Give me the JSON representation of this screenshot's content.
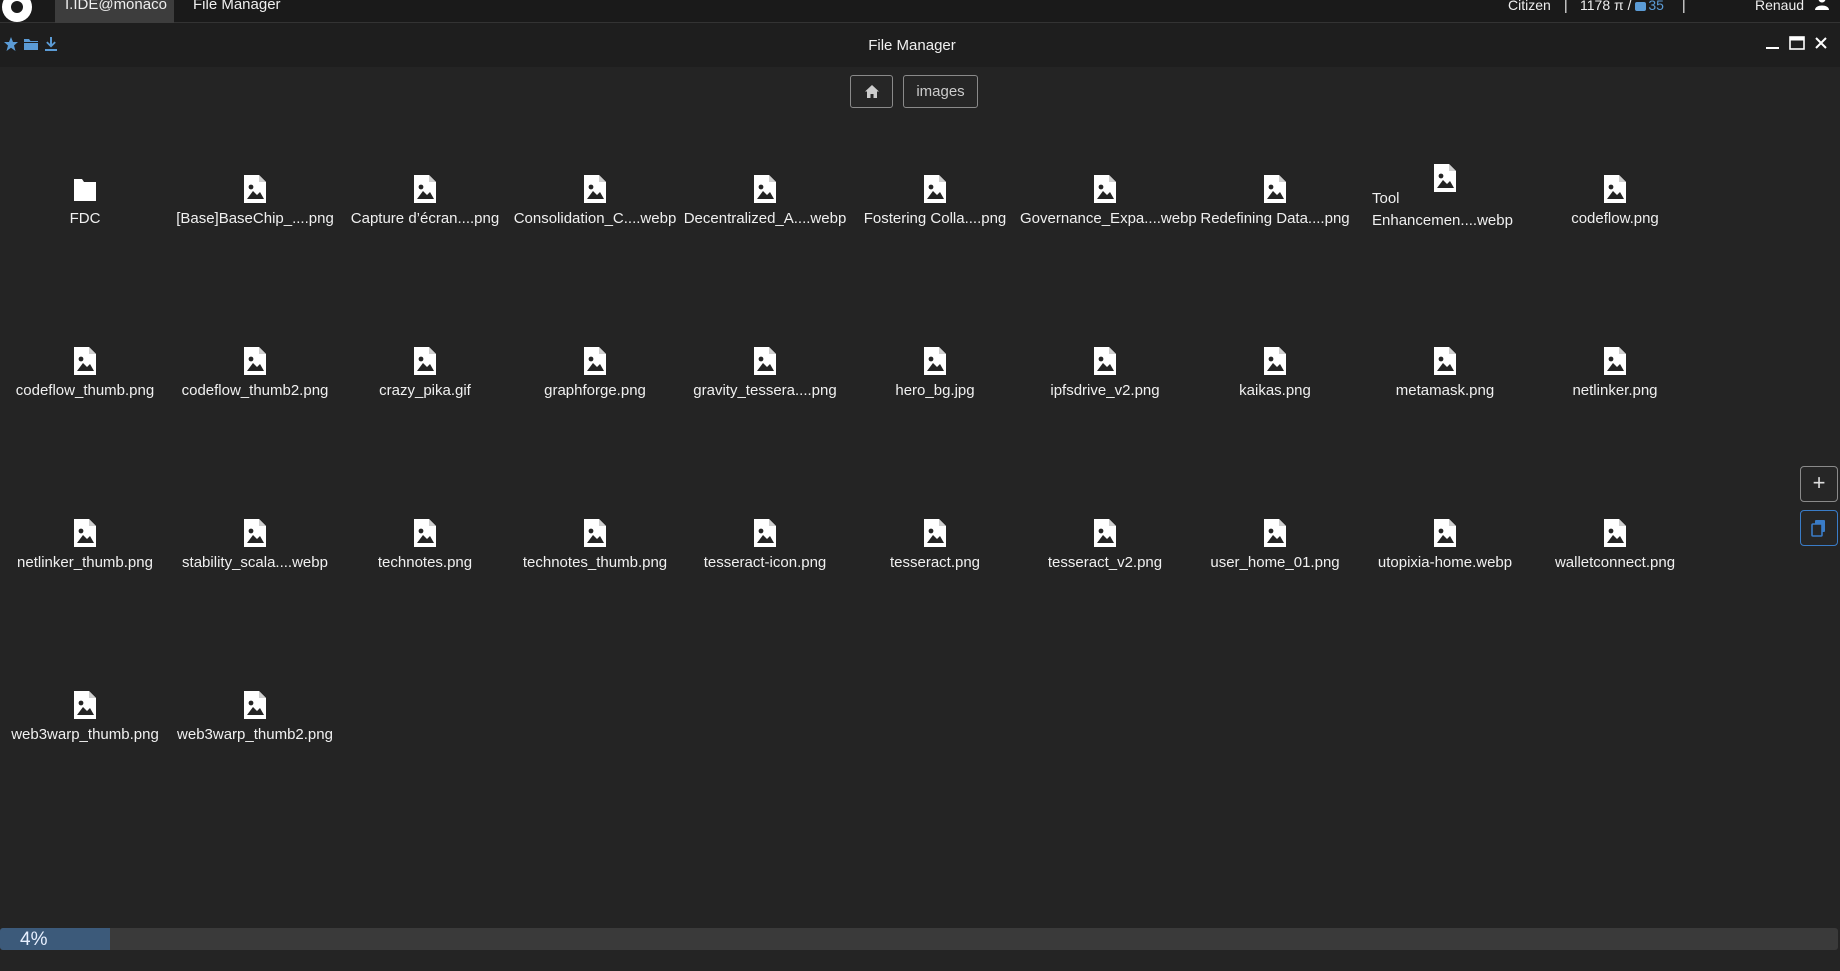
{
  "topbar": {
    "tabs": [
      "I.IDE@monaco",
      "File Manager"
    ],
    "role": "Citizen",
    "separator": "|",
    "balance_amount": "1178 π / ",
    "balance_count": "35",
    "user_name": "Renaud"
  },
  "window": {
    "title": "File Manager",
    "left_icons": [
      "star-icon",
      "folder-icon",
      "download-icon"
    ],
    "controls": [
      "minimize-icon",
      "maximize-icon",
      "close-icon"
    ]
  },
  "breadcrumb": {
    "home_icon": "home-icon",
    "current": "images"
  },
  "files": [
    {
      "name": "FDC",
      "kind": "folder"
    },
    {
      "name": "[Base]BaseChip_....png",
      "kind": "image"
    },
    {
      "name": "Capture d’écran....png",
      "kind": "image"
    },
    {
      "name": "Consolidation_C....webp",
      "kind": "image"
    },
    {
      "name": "Decentralized_A....webp",
      "kind": "image"
    },
    {
      "name": "Fostering Colla....png",
      "kind": "image"
    },
    {
      "name": "Governance_Expa....webp",
      "kind": "image"
    },
    {
      "name": "Redefining Data....png",
      "kind": "image"
    },
    {
      "name": "Tool Enhancemen....webp",
      "kind": "image",
      "wrap": true
    },
    {
      "name": "codeflow.png",
      "kind": "image"
    },
    {
      "name": "codeflow_thumb.png",
      "kind": "image"
    },
    {
      "name": "codeflow_thumb2.png",
      "kind": "image"
    },
    {
      "name": "crazy_pika.gif",
      "kind": "image"
    },
    {
      "name": "graphforge.png",
      "kind": "image"
    },
    {
      "name": "gravity_tessera....png",
      "kind": "image"
    },
    {
      "name": "hero_bg.jpg",
      "kind": "image"
    },
    {
      "name": "ipfsdrive_v2.png",
      "kind": "image"
    },
    {
      "name": "kaikas.png",
      "kind": "image"
    },
    {
      "name": "metamask.png",
      "kind": "image"
    },
    {
      "name": "netlinker.png",
      "kind": "image"
    },
    {
      "name": "netlinker_thumb.png",
      "kind": "image"
    },
    {
      "name": "stability_scala....webp",
      "kind": "image"
    },
    {
      "name": "technotes.png",
      "kind": "image"
    },
    {
      "name": "technotes_thumb.png",
      "kind": "image"
    },
    {
      "name": "tesseract-icon.png",
      "kind": "image"
    },
    {
      "name": "tesseract.png",
      "kind": "image"
    },
    {
      "name": "tesseract_v2.png",
      "kind": "image"
    },
    {
      "name": "user_home_01.png",
      "kind": "image"
    },
    {
      "name": "utopixia-home.webp",
      "kind": "image"
    },
    {
      "name": "walletconnect.png",
      "kind": "image"
    },
    {
      "name": "web3warp_thumb.png",
      "kind": "image"
    },
    {
      "name": "web3warp_thumb2.png",
      "kind": "image"
    }
  ],
  "side_buttons": {
    "add_label": "+",
    "copy_icon": "copy-icon"
  },
  "progress": {
    "label": "4%",
    "value": 0.04
  },
  "colors": {
    "accent": "#5b9bd5",
    "progress_fill": "#3c5a7a",
    "background": "#242424"
  }
}
